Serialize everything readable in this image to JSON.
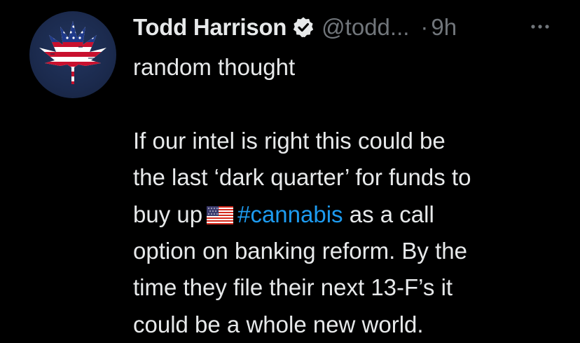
{
  "author": {
    "name": "Todd Harrison",
    "handle": "@todd...",
    "separator": "·",
    "time": "9h",
    "avatar_icon": "american-flag-cannabis-leaf-avatar",
    "verified_icon": "verified-badge-icon"
  },
  "actions": {
    "more_icon": "more-options-icon"
  },
  "tweet": {
    "line1": "random thought",
    "line2": "If our intel is right this could be",
    "line3": "the last ‘dark quarter’ for funds to",
    "line4_before": "buy up",
    "line4_emoji": "us-flag-emoji",
    "line4_hashtag": "#cannabis",
    "line4_after": "as a call",
    "line5": "option on banking reform.  By the",
    "line6": "time they file their next 13-F’s it",
    "line7": "could be a whole new world."
  },
  "colors": {
    "background": "#000000",
    "text": "#e7e9ea",
    "muted": "#71767b",
    "link": "#1d9bf0"
  }
}
